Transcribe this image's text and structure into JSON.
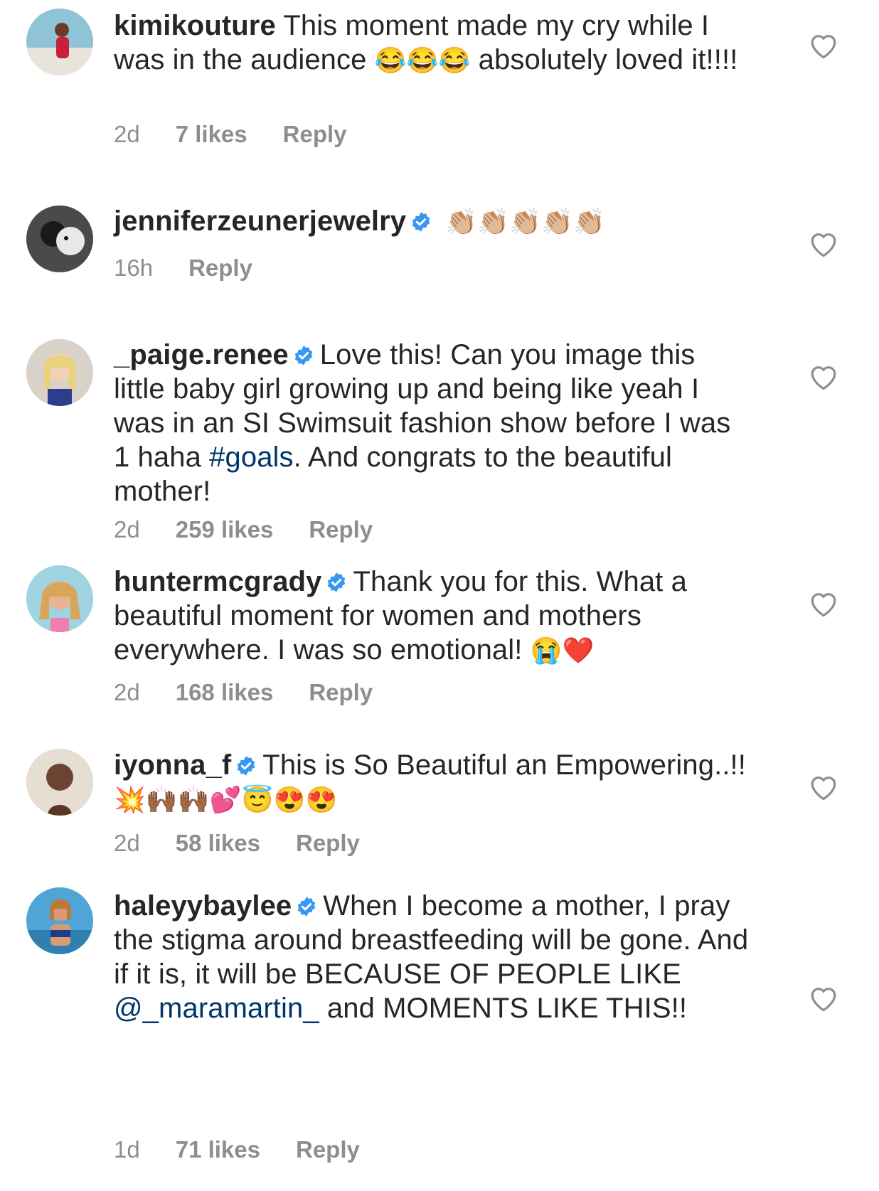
{
  "comments": [
    {
      "username": "kimikouture",
      "verified": false,
      "text_parts": [
        " This moment made my cry while I was in the audience ",
        "😂😂😂",
        " absolutely loved it!!!!"
      ],
      "time": "2d",
      "likes": "7 likes",
      "reply": "Reply"
    },
    {
      "username": "jenniferzeunerjewelry",
      "verified": true,
      "text_parts": [
        " ",
        "👏🏼👏🏼👏🏼👏🏼👏🏼",
        ""
      ],
      "time": "16h",
      "likes": "",
      "reply": "Reply"
    },
    {
      "username": "_paige.renee",
      "verified": true,
      "text_parts": [
        "Love this! Can you image this little baby girl growing up and being like yeah I was in an SI Swimsuit fashion show before I was 1 haha ",
        "#goals",
        ". And congrats to the beautiful mother!"
      ],
      "time": "2d",
      "likes": "259 likes",
      "reply": "Reply"
    },
    {
      "username": "huntermcgrady",
      "verified": true,
      "text_parts": [
        "Thank you for this. What a beautiful moment for women and mothers everywhere. I was so emotional! ",
        "😭❤️",
        ""
      ],
      "time": "2d",
      "likes": "168 likes",
      "reply": "Reply"
    },
    {
      "username": "iyonna_f",
      "verified": true,
      "text_parts": [
        "This is So Beautiful an Empowering..!! ",
        "💥🙌🏾🙌🏾💕😇😍😍",
        ""
      ],
      "time": "2d",
      "likes": "58 likes",
      "reply": "Reply"
    },
    {
      "username": "haleyybaylee",
      "verified": true,
      "text_parts": [
        "When I become a mother, I pray the stigma around breastfeeding will be gone. And if it is, it will be BECAUSE OF PEOPLE LIKE ",
        "@_maramartin_",
        " and MOMENTS LIKE THIS!!"
      ],
      "time": "1d",
      "likes": "71 likes",
      "reply": "Reply"
    }
  ],
  "colors": {
    "text": "#262626",
    "meta": "#8e8e8e",
    "link": "#00376b",
    "verified": "#3897f0"
  },
  "icons": {
    "like": "heart-outline-icon",
    "verified": "verified-badge-icon"
  }
}
